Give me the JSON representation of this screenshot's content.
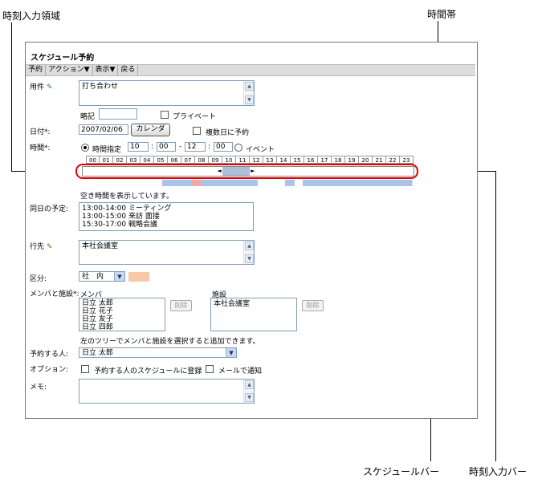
{
  "callouts": {
    "time_input_area": "時刻入力領域",
    "time_band": "時間帯",
    "schedule_bar": "スケジュールバー",
    "time_input_bar": "時刻入力バー"
  },
  "page_title": "スケジュール予約",
  "menu": [
    "予約",
    "アクション▼",
    "表示▼",
    "戻る"
  ],
  "form": {
    "subject_label": "用件",
    "subject_value": "打ち合わせ",
    "abbrev_label": "略記",
    "abbrev_value": "",
    "private_label": "プライベート",
    "date_label": "日付*:",
    "date_value": "2007/02/06",
    "calendar_button": "カレンダ",
    "multi_day_label": "複数日に予約",
    "time_label": "時間*:",
    "time_spec_label": "時間指定",
    "start_hour": "10",
    "start_min": "00",
    "time_sep": "-",
    "time_colon": ":",
    "end_hour": "12",
    "end_min": "00",
    "event_label": "イベント",
    "hours": [
      "00",
      "01",
      "02",
      "03",
      "04",
      "05",
      "06",
      "07",
      "08",
      "09",
      "10",
      "11",
      "12",
      "13",
      "14",
      "15",
      "16",
      "17",
      "18",
      "19",
      "20",
      "21",
      "22",
      "23"
    ],
    "free_time_note": "空き時間を表示しています。",
    "same_day_label": "同日の予定:",
    "same_day_text": "13:00-14:00 ミーティング\n13:00-15:00 来訪 面接\n15:30-17:00 戦略会議",
    "destination_label": "行先",
    "destination_value": "本社会議室",
    "category_label": "区分:",
    "category_value": "社　内",
    "category_color": "#f7c9a6",
    "members_facilities_label": "メンバと施設*:",
    "members_header": "メンバ",
    "members_text": "日立 太郎\n日立 花子\n日立 友子\n日立 四郎",
    "remove_button": "削除",
    "facilities_header": "施設",
    "facilities_text": "本社会議室",
    "facility_remove_button": "削除",
    "tree_hint": "左のツリーでメンバと施設を選択すると追加できます。",
    "reserver_label": "予約する人:",
    "reserver_value": "日立 太郎",
    "options_label": "オプション:",
    "option_register": "予約する人のスケジュールに登録",
    "option_mail": "メールで通知",
    "memo_label": "メモ:",
    "memo_value": ""
  },
  "colors": {
    "callout_red": "#e00000",
    "busy_blue": "#a9c4ea",
    "busy_pink": "#f4a7a7",
    "slider_blue": "#aebfdc"
  }
}
